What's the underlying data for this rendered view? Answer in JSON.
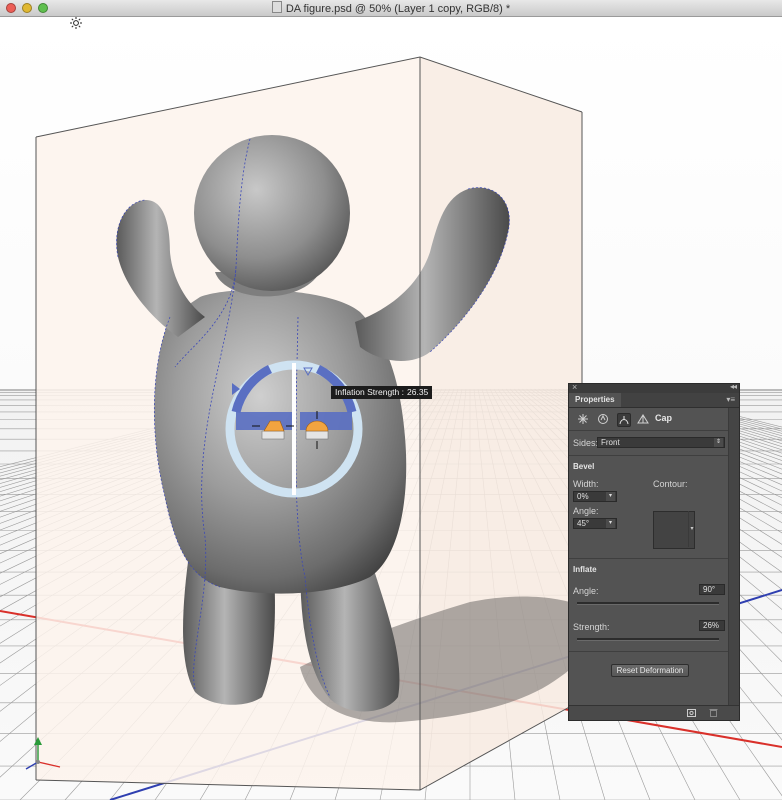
{
  "window": {
    "title": "DA figure.psd @ 50% (Layer 1 copy, RGB/8) *",
    "traffic_lights": {
      "close": "#ec5f57",
      "minimize": "#e0b832",
      "zoom": "#5fbf4e"
    }
  },
  "canvas": {
    "light_icon": "light-source-icon",
    "axes_icon": "xyz-axis-widget-icon"
  },
  "hud": {
    "label": "Inflation Strength",
    "separator": ":",
    "value": "26.35"
  },
  "properties_panel": {
    "tab_label": "Properties",
    "mode_icons": [
      "3d-mesh-icon",
      "deform-icon",
      "cap-icon",
      "coordinates-icon"
    ],
    "section_label": "Cap",
    "sides": {
      "label": "Sides:",
      "value": "Front"
    },
    "bevel": {
      "heading": "Bevel",
      "width_label": "Width:",
      "width_value": "0%",
      "angle_label": "Angle:",
      "angle_value": "45°",
      "contour_label": "Contour:"
    },
    "inflate": {
      "heading": "Inflate",
      "angle_label": "Angle:",
      "angle_value": "90°",
      "angle_fraction": 1.0,
      "strength_label": "Strength:",
      "strength_value": "26%",
      "strength_fraction": 0.26
    },
    "reset_button": "Reset Deformation",
    "bottom_icons": [
      "render-icon",
      "trash-icon"
    ]
  },
  "colors": {
    "panel_bg": "#535353",
    "inflate_ring_dark": "#5a6fc2",
    "inflate_ring_light": "#cfe3f2",
    "inflate_handle": "#f2a440",
    "x_axis": "#d9302a",
    "z_axis": "#2f3fb0",
    "y_axis": "#2a9a3a"
  }
}
